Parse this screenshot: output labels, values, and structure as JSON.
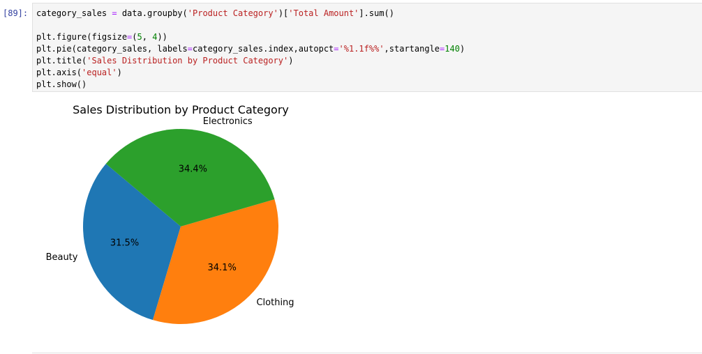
{
  "cell": {
    "prompt": "[89]:",
    "code_lines": [
      [
        [
          "category_sales ",
          "plain"
        ],
        [
          "=",
          "op"
        ],
        [
          " data.groupby(",
          "plain"
        ],
        [
          "'Product Category'",
          "str"
        ],
        [
          ")[",
          "plain"
        ],
        [
          "'Total Amount'",
          "str"
        ],
        [
          "].sum()",
          "plain"
        ]
      ],
      [],
      [
        [
          "plt.figure(figsize",
          "plain"
        ],
        [
          "=",
          "op"
        ],
        [
          "(",
          "plain"
        ],
        [
          "5",
          "num"
        ],
        [
          ", ",
          "plain"
        ],
        [
          "4",
          "num"
        ],
        [
          "))",
          "plain"
        ]
      ],
      [
        [
          "plt.pie(category_sales, labels",
          "plain"
        ],
        [
          "=",
          "op"
        ],
        [
          "category_sales.index,autopct",
          "plain"
        ],
        [
          "=",
          "op"
        ],
        [
          "'%1.1f%%'",
          "str"
        ],
        [
          ",startangle",
          "plain"
        ],
        [
          "=",
          "op"
        ],
        [
          "140",
          "num"
        ],
        [
          ")",
          "plain"
        ]
      ],
      [
        [
          "plt.title(",
          "plain"
        ],
        [
          "'Sales Distribution by Product Category'",
          "str"
        ],
        [
          ")",
          "plain"
        ]
      ],
      [
        [
          "plt.axis(",
          "plain"
        ],
        [
          "'equal'",
          "str"
        ],
        [
          ")",
          "plain"
        ]
      ],
      [
        [
          "plt.show()",
          "plain"
        ]
      ]
    ]
  },
  "colors": {
    "syntax_string": "#ba2121",
    "syntax_number": "#008000",
    "syntax_operator": "#aa22ff",
    "prompt": "#303f9f"
  },
  "chart_data": {
    "type": "pie",
    "title": "Sales Distribution by Product Category",
    "start_angle_deg": 140,
    "direction": "counterclockwise",
    "slices": [
      {
        "label": "Beauty",
        "value": 31.5,
        "pct_label": "31.5%",
        "color": "#1f77b4"
      },
      {
        "label": "Clothing",
        "value": 34.1,
        "pct_label": "34.1%",
        "color": "#ff7f0e"
      },
      {
        "label": "Electronics",
        "value": 34.4,
        "pct_label": "34.4%",
        "color": "#2ca02c"
      }
    ]
  }
}
